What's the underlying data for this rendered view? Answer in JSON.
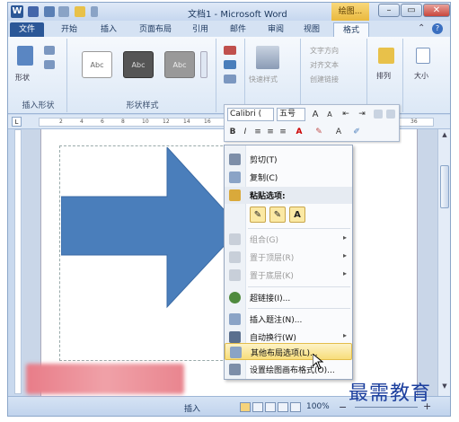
{
  "titlebar": {
    "word_icon": "W",
    "title": "文档1 - Microsoft Word",
    "context_tab_title": "绘图...",
    "minimize": "–",
    "restore": "▭",
    "close": "✕"
  },
  "tabs": [
    {
      "label": "文件"
    },
    {
      "label": "开始"
    },
    {
      "label": "插入"
    },
    {
      "label": "页面布局"
    },
    {
      "label": "引用"
    },
    {
      "label": "邮件"
    },
    {
      "label": "审阅"
    },
    {
      "label": "视图"
    },
    {
      "label": "格式"
    }
  ],
  "tab_right": {
    "collapse": "⌃",
    "help": "?"
  },
  "ribbon": {
    "insert_shapes": {
      "shape_button": "形状",
      "group_label": "插入形状"
    },
    "shape_styles": {
      "samples": [
        "Abc",
        "Abc",
        "Abc"
      ],
      "group_label": "形状样式"
    },
    "wordart": {
      "quick_styles": "快速样式",
      "text_direction": "文字方向",
      "align_text": "对齐文本",
      "create_link": "创建链接"
    },
    "arrange": {
      "label": "排列"
    },
    "size": {
      "label": "大小"
    }
  },
  "ruler": {
    "corner": "L",
    "numbers": [
      "2",
      "4",
      "6",
      "8",
      "10",
      "12",
      "14",
      "16",
      "18",
      "20",
      "22",
      "24",
      "26",
      "28",
      "30",
      "32",
      "34",
      "36"
    ]
  },
  "mini_toolbar": {
    "font": "Calibri (",
    "size": "五号",
    "row1_buttons": [
      "A",
      "A",
      "⇤",
      "⇥"
    ],
    "row2_buttons": [
      "B",
      "I",
      "≡",
      "≡",
      "≡",
      "A",
      "✎",
      "A",
      "✐"
    ]
  },
  "context_menu": {
    "items": [
      {
        "label": "剪切(T)",
        "icon": "scissors-icon",
        "disabled": false
      },
      {
        "label": "复制(C)",
        "icon": "copy-icon",
        "disabled": false
      },
      {
        "label": "粘贴选项:",
        "icon": "paste-icon",
        "disabled": false,
        "header": true
      },
      {
        "label": "组合(G)",
        "icon": "group-icon",
        "disabled": true,
        "submenu": true
      },
      {
        "label": "置于顶层(R)",
        "icon": "bring-front-icon",
        "disabled": true,
        "submenu": true
      },
      {
        "label": "置于底层(K)",
        "icon": "send-back-icon",
        "disabled": true,
        "submenu": true
      },
      {
        "label": "超链接(I)...",
        "icon": "hyperlink-icon",
        "disabled": false
      },
      {
        "label": "插入题注(N)...",
        "icon": "caption-icon",
        "disabled": false
      },
      {
        "label": "自动换行(W)",
        "icon": "wrap-text-icon",
        "disabled": false,
        "submenu": true
      },
      {
        "label": "其他布局选项(L)...",
        "icon": "layout-options-icon",
        "disabled": false,
        "highlighted": true
      },
      {
        "label": "设置绘图画布格式(O)...",
        "icon": "format-canvas-icon",
        "disabled": false
      }
    ],
    "paste_options": [
      "✎",
      "✎",
      "A"
    ],
    "submenu_arrow": "▸"
  },
  "statusbar": {
    "insert_mode": "插入",
    "zoom": "100%",
    "zoom_minus": "−",
    "zoom_plus": "+"
  },
  "scrollbar": {
    "up": "▲",
    "down": "▼"
  },
  "watermark": "最需教育",
  "colors": {
    "arrow_fill": "#4a7ebb",
    "arrow_stroke": "#3a6aa4",
    "file_tab": "#2b5797",
    "context_tab": "#e9b93e",
    "menu_highlight": "#f7dd7a",
    "watermark": "#1c3f9e"
  }
}
